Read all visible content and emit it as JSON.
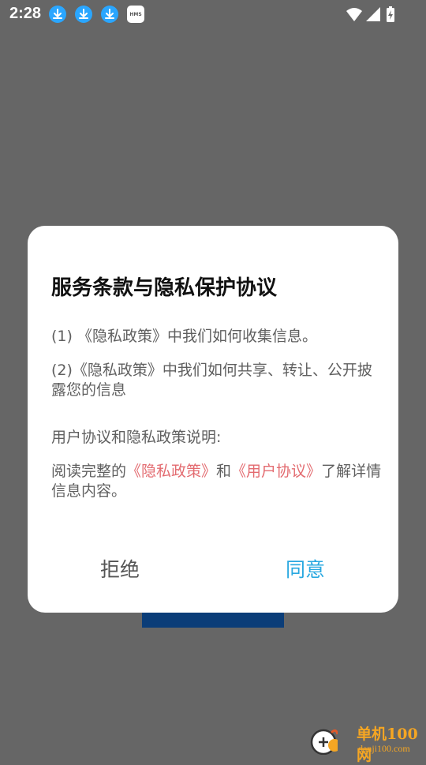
{
  "status_bar": {
    "time": "2:28",
    "notification_icons": [
      "download-icon",
      "download-icon",
      "download-icon",
      "hms-icon"
    ],
    "hms_label": "HMS",
    "system_icons": [
      "wifi-icon",
      "signal-icon",
      "battery-charging-icon"
    ]
  },
  "dialog": {
    "title": "服务条款与隐私保护协议",
    "item1": "(1) 《隐私政策》中我们如何收集信息。",
    "item2": "(2)《隐私政策》中我们如何共享、转让、公开披露您的信息",
    "section_label": "用户协议和隐私政策说明:",
    "read_prefix": "阅读完整的",
    "privacy_link": "《隐私政策》",
    "and_text": "和",
    "user_link": "《用户协议》",
    "read_suffix": "了解详情信息内容。",
    "reject_label": "拒绝",
    "agree_label": "同意",
    "colors": {
      "link": "#e36b70",
      "agree": "#29a8e0",
      "dim": "#666666"
    }
  },
  "watermark": {
    "line1": "单机100网",
    "line2": "danji100.com"
  }
}
